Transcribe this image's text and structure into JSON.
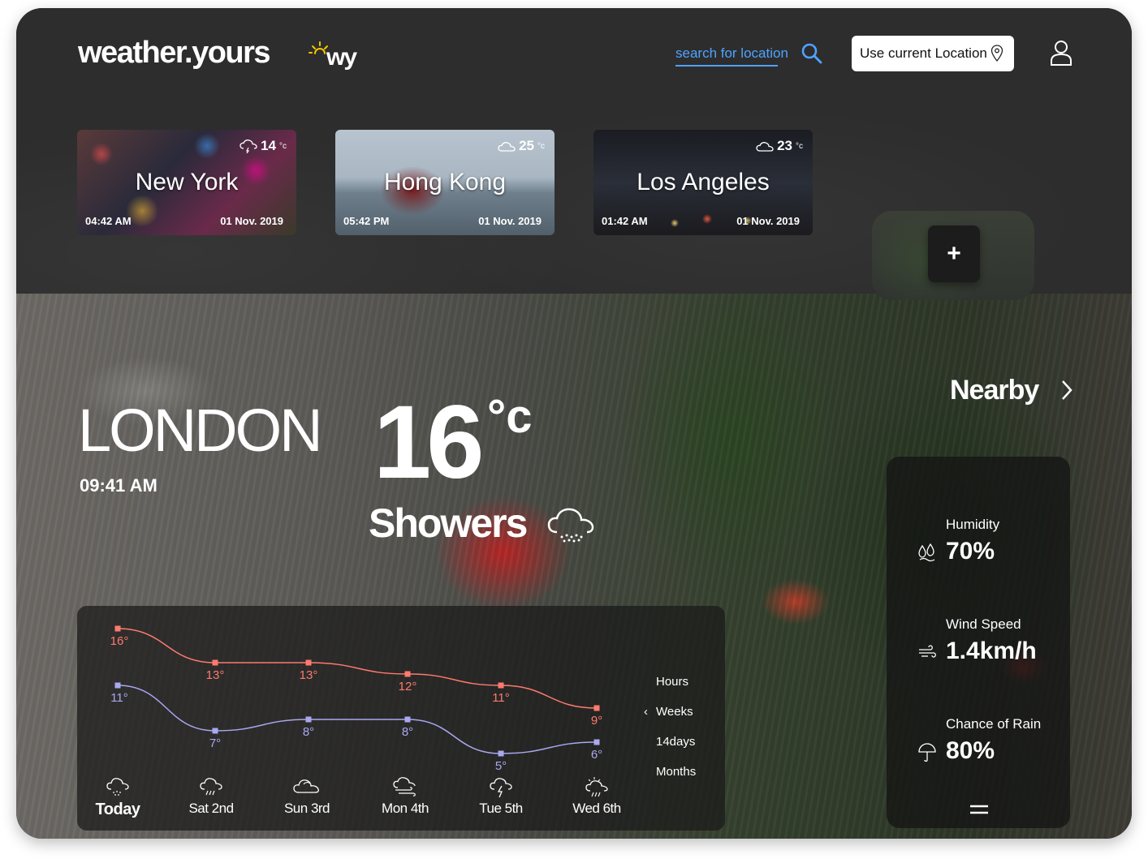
{
  "header": {
    "brand": "weather.yours",
    "logo_text": "wy",
    "search_placeholder": "search for location",
    "use_location_label": "Use current Location"
  },
  "cities": [
    {
      "name": "New York",
      "temp": "14",
      "unit": "°c",
      "time": "04:42 AM",
      "date": "01 Nov. 2019",
      "icon": "rain-cloud-icon"
    },
    {
      "name": "Hong Kong",
      "temp": "25",
      "unit": "°c",
      "time": "05:42 PM",
      "date": "01 Nov. 2019",
      "icon": "cloud-icon"
    },
    {
      "name": "Los Angeles",
      "temp": "23",
      "unit": "°c",
      "time": "01:42 AM",
      "date": "01 Nov. 2019",
      "icon": "cloud-icon"
    }
  ],
  "add_city_label": "+",
  "current": {
    "city": "LONDON",
    "time": "09:41 AM",
    "temp": "16",
    "unit": "°c",
    "condition": "Showers"
  },
  "nearby_label": "Nearby",
  "stats": [
    {
      "label": "Humidity",
      "value": "70%",
      "icon": "humidity-icon"
    },
    {
      "label": "Wind Speed",
      "value": "1.4km/h",
      "icon": "wind-icon"
    },
    {
      "label": "Chance of Rain",
      "value": "80%",
      "icon": "umbrella-icon"
    }
  ],
  "range_options": [
    "Hours",
    "Weeks",
    "14days",
    "Months"
  ],
  "days": [
    {
      "label": "Today",
      "icon": "showers-icon"
    },
    {
      "label": "Sat 2nd",
      "icon": "rain-icon"
    },
    {
      "label": "Sun 3rd",
      "icon": "cloud-icon"
    },
    {
      "label": "Mon 4th",
      "icon": "windy-cloud-icon"
    },
    {
      "label": "Tue 5th",
      "icon": "thunder-icon"
    },
    {
      "label": "Wed 6th",
      "icon": "sun-rain-icon"
    }
  ],
  "chart_data": {
    "type": "line",
    "categories": [
      "Today",
      "Sat 2nd",
      "Sun 3rd",
      "Mon 4th",
      "Tue 5th",
      "Wed 6th"
    ],
    "series": [
      {
        "values": [
          16,
          13,
          13,
          12,
          11,
          9
        ],
        "labels": [
          "16°",
          "13°",
          "13°",
          "12°",
          "11°",
          "9°"
        ],
        "color": "#ff7a6e"
      },
      {
        "values": [
          11,
          7,
          8,
          8,
          5,
          6
        ],
        "labels": [
          "11°",
          "7°",
          "8°",
          "8°",
          "5°",
          "6°"
        ],
        "color": "#a9a8f0"
      }
    ],
    "ylim": [
      4,
      17
    ]
  }
}
